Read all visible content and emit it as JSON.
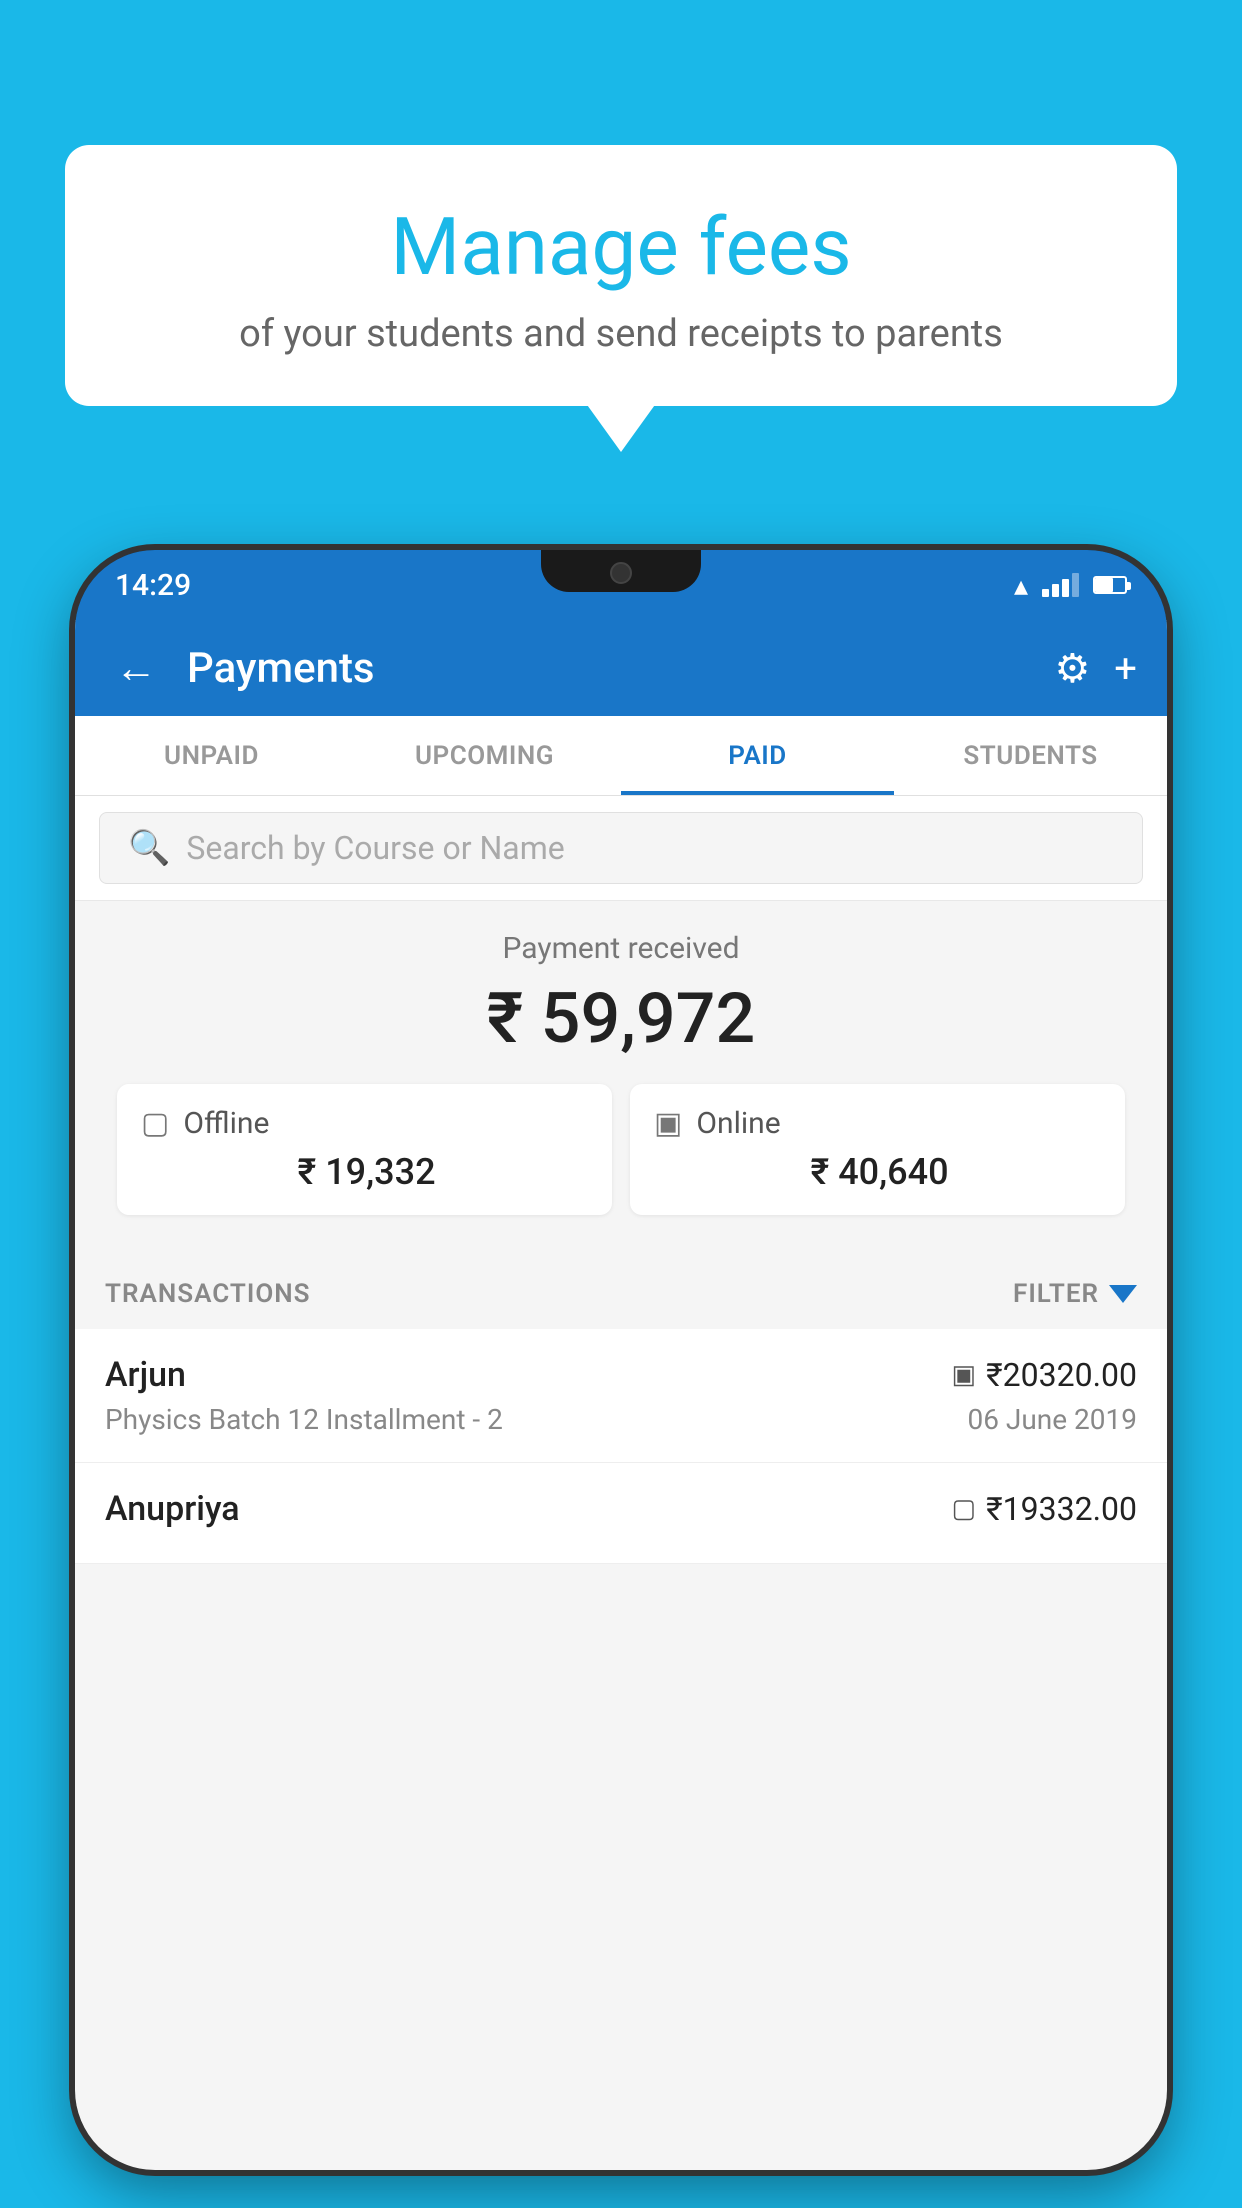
{
  "page": {
    "background_color": "#1ab8e8"
  },
  "bubble": {
    "title": "Manage fees",
    "subtitle": "of your students and send receipts to parents"
  },
  "status_bar": {
    "time": "14:29"
  },
  "app": {
    "title": "Payments",
    "tabs": [
      {
        "label": "UNPAID",
        "active": false
      },
      {
        "label": "UPCOMING",
        "active": false
      },
      {
        "label": "PAID",
        "active": true
      },
      {
        "label": "STUDENTS",
        "active": false
      }
    ],
    "search": {
      "placeholder": "Search by Course or Name"
    },
    "payment_received": {
      "label": "Payment received",
      "amount": "₹ 59,972"
    },
    "cards": [
      {
        "id": "offline",
        "label": "Offline",
        "amount": "₹ 19,332",
        "icon": "offline-payment-icon"
      },
      {
        "id": "online",
        "label": "Online",
        "amount": "₹ 40,640",
        "icon": "online-payment-icon"
      }
    ],
    "transactions_label": "TRANSACTIONS",
    "filter_label": "FILTER",
    "transactions": [
      {
        "name": "Arjun",
        "course": "Physics Batch 12 Installment - 2",
        "amount": "₹20320.00",
        "date": "06 June 2019",
        "payment_mode": "online"
      },
      {
        "name": "Anupriya",
        "course": "",
        "amount": "₹19332.00",
        "date": "",
        "payment_mode": "offline"
      }
    ]
  }
}
